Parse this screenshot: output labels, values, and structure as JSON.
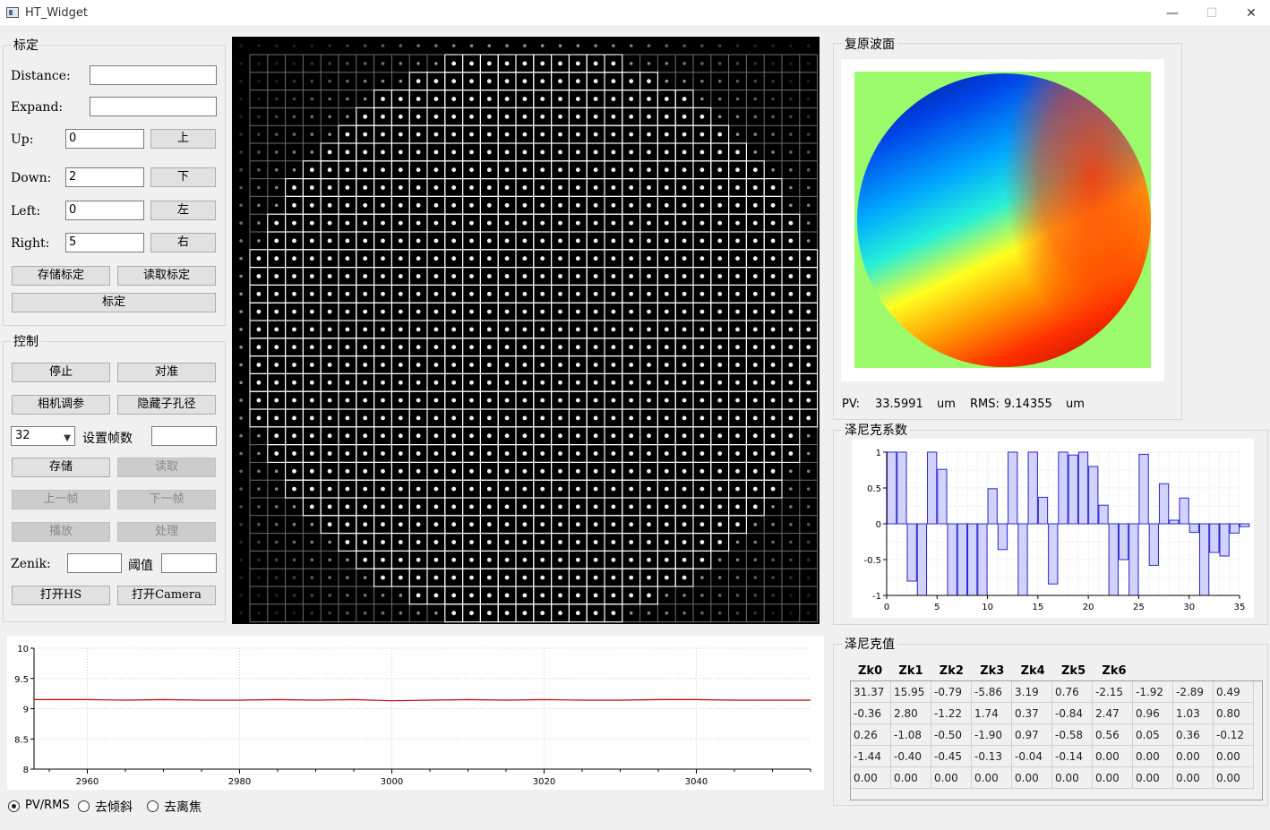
{
  "window": {
    "title": "HT_Widget",
    "minimize": "—",
    "maximize": "☐",
    "close": "✕"
  },
  "calib": {
    "title": "标定",
    "distance_label": "Distance:",
    "distance_value": "",
    "expand_label": "Expand:",
    "expand_value": "",
    "up_label": "Up:",
    "up_value": "0",
    "up_btn": "上",
    "down_label": "Down:",
    "down_value": "2",
    "down_btn": "下",
    "left_label": "Left:",
    "left_value": "0",
    "left_btn": "左",
    "right_label": "Right:",
    "right_value": "5",
    "right_btn": "右",
    "save_btn": "存储标定",
    "load_btn": "读取标定",
    "calib_btn": "标定"
  },
  "control": {
    "title": "控制",
    "stop_btn": "停止",
    "align_btn": "对准",
    "camera_btn": "相机调参",
    "hide_btn": "隐藏子孔径",
    "frames_select": "32",
    "frames_label": "设置帧数",
    "frames_value": "",
    "store_btn": "存储",
    "read_btn": "读取",
    "prev_btn": "上一帧",
    "next_btn": "下一帧",
    "play_btn": "播放",
    "process_btn": "处理",
    "zenik_label": "Zenik:",
    "zenik_value": "",
    "threshold_label": "阈值",
    "threshold_value": "",
    "open_hs_btn": "打开HS",
    "open_camera_btn": "打开Camera"
  },
  "wavefront": {
    "title": "复原波面",
    "pv_label": "PV:",
    "pv_value": "33.5991",
    "pv_unit": "um",
    "rms_label": "RMS:",
    "rms_value": "9.14355",
    "rms_unit": "um"
  },
  "zernike_coef": {
    "title": "泽尼克系数",
    "chart_data": {
      "type": "bar",
      "x": [
        0,
        1,
        2,
        3,
        4,
        5,
        6,
        7,
        8,
        9,
        10,
        11,
        12,
        13,
        14,
        15,
        16,
        17,
        18,
        19,
        20,
        21,
        22,
        23,
        24,
        25,
        26,
        27,
        28,
        29,
        30,
        31,
        32,
        33,
        34
      ],
      "values": [
        1,
        1,
        -0.8,
        -1,
        1,
        0.76,
        -1,
        -1,
        -1,
        -1,
        0.49,
        -0.36,
        1,
        -1,
        1,
        0.37,
        -0.84,
        1,
        0.96,
        1,
        0.8,
        0.26,
        -1,
        -0.5,
        -1,
        0.97,
        -0.58,
        0.56,
        0.05,
        0.36,
        -0.12,
        -1,
        -0.4,
        -0.45,
        -0.13,
        -0.04
      ],
      "xlim": [
        0,
        35
      ],
      "ylim": [
        -1,
        1
      ],
      "x_ticks": [
        "0",
        "5",
        "10",
        "15",
        "20",
        "25",
        "30",
        "35"
      ],
      "y_ticks": [
        "1",
        "0.5",
        "0",
        "-0.5",
        "-1"
      ],
      "grid": true
    }
  },
  "zernike_values": {
    "title": "泽尼克值",
    "headers": [
      "Zk0",
      "Zk1",
      "Zk2",
      "Zk3",
      "Zk4",
      "Zk5",
      "Zk6"
    ],
    "rows": [
      [
        "31.37",
        "15.95",
        "-0.79",
        "-5.86",
        "3.19",
        "0.76",
        "-2.15",
        "-1.92",
        "-2.89",
        "0.49"
      ],
      [
        "-0.36",
        "2.80",
        "-1.22",
        "1.74",
        "0.37",
        "-0.84",
        "2.47",
        "0.96",
        "1.03",
        "0.80"
      ],
      [
        "0.26",
        "-1.08",
        "-0.50",
        "-1.90",
        "0.97",
        "-0.58",
        "0.56",
        "0.05",
        "0.36",
        "-0.12"
      ],
      [
        "-1.44",
        "-0.40",
        "-0.45",
        "-0.13",
        "-0.04",
        "-0.14",
        "0.00",
        "0.00",
        "0.00",
        "0.00"
      ],
      [
        "0.00",
        "0.00",
        "0.00",
        "0.00",
        "0.00",
        "0.00",
        "0.00",
        "0.00",
        "0.00",
        "0.00"
      ]
    ]
  },
  "trend": {
    "chart_data": {
      "type": "line",
      "x": [
        2953,
        2960,
        2965,
        2970,
        2975,
        2980,
        2985,
        2990,
        2995,
        3000,
        3005,
        3010,
        3015,
        3020,
        3025,
        3030,
        3035,
        3040,
        3045,
        3050,
        3055
      ],
      "values": [
        9.15,
        9.15,
        9.14,
        9.15,
        9.14,
        9.14,
        9.15,
        9.14,
        9.15,
        9.13,
        9.14,
        9.15,
        9.14,
        9.15,
        9.14,
        9.14,
        9.15,
        9.15,
        9.14,
        9.14,
        9.14
      ],
      "xlim": [
        2953,
        3055
      ],
      "ylim": [
        8,
        10
      ],
      "x_ticks": [
        "2960",
        "2980",
        "3000",
        "3020",
        "3040"
      ],
      "y_ticks": [
        "10",
        "9.5",
        "9",
        "8.5",
        "8"
      ],
      "line_color": "#c00000",
      "grid": true
    }
  },
  "mode": {
    "pvrms": "PV/RMS",
    "tilt": "去倾斜",
    "defocus": "去离焦"
  }
}
